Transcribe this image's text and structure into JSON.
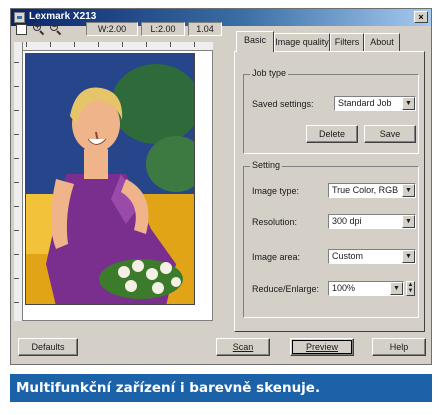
{
  "window": {
    "title": "Lexmark X213",
    "close_glyph": "×"
  },
  "preview_toolbar": {
    "zoom_in_sign": "+",
    "zoom_out_sign": "−",
    "width_readout": "W:2.00",
    "left_readout": "L:2.00",
    "extra_readout": "1.04"
  },
  "tabs": [
    {
      "label": "Basic",
      "active": true
    },
    {
      "label": "Image quality",
      "active": false
    },
    {
      "label": "Filters",
      "active": false
    },
    {
      "label": "About",
      "active": false
    }
  ],
  "job_type": {
    "group_label": "Job type",
    "saved_settings_label": "Saved settings:",
    "saved_settings_value": "Standard Job",
    "delete_label": "Delete",
    "save_label": "Save"
  },
  "setting": {
    "group_label": "Setting",
    "image_type_label": "Image type:",
    "image_type_value": "True Color, RGB",
    "resolution_label": "Resolution:",
    "resolution_value": "300 dpi",
    "image_area_label": "Image area:",
    "image_area_value": "Custom",
    "reduce_enlarge_label": "Reduce/Enlarge:",
    "reduce_enlarge_value": "100%"
  },
  "bottom_buttons": {
    "defaults": "Defaults",
    "scan": "Scan",
    "preview": "Preview",
    "help": "Help"
  },
  "caption": "Multifunkční zařízení i barevně skenuje.",
  "colors": {
    "title_bar": "#0a246a",
    "caption_bar": "#1c62a8",
    "window_face": "#d4d0c8"
  }
}
